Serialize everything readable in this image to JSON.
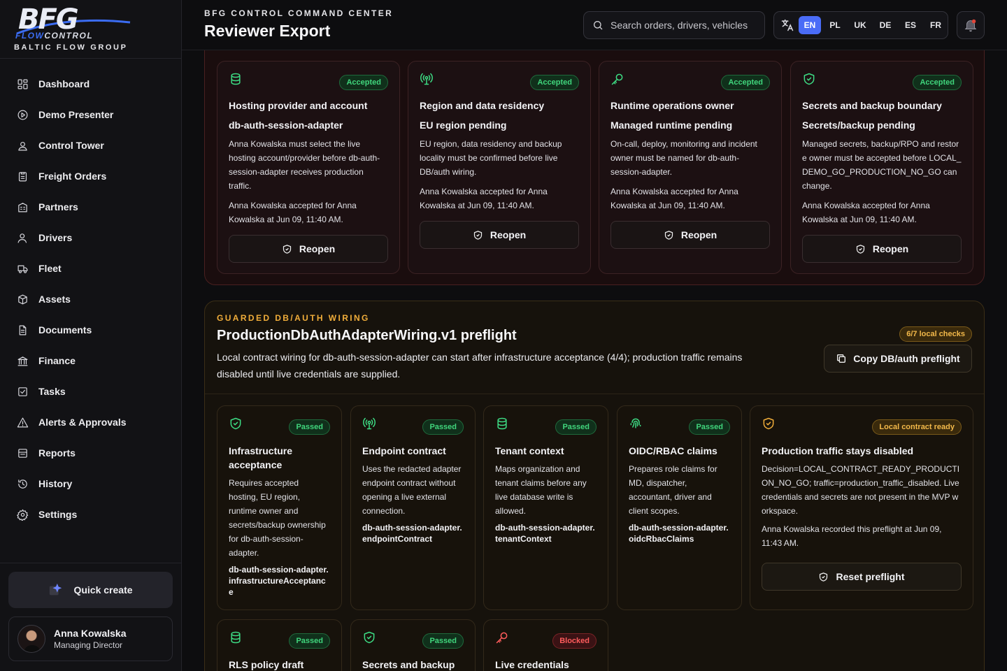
{
  "brand": {
    "logo": "BFG",
    "logo_flow": "FLOW",
    "logo_control": "CONTROL",
    "subtitle": "BALTIC FLOW GROUP"
  },
  "sidebar": {
    "items": [
      {
        "label": "Dashboard",
        "icon": "grid-icon"
      },
      {
        "label": "Demo Presenter",
        "icon": "play-circle-icon"
      },
      {
        "label": "Control Tower",
        "icon": "user-badge-icon"
      },
      {
        "label": "Freight Orders",
        "icon": "clipboard-icon"
      },
      {
        "label": "Partners",
        "icon": "building-icon"
      },
      {
        "label": "Drivers",
        "icon": "user-icon"
      },
      {
        "label": "Fleet",
        "icon": "truck-icon"
      },
      {
        "label": "Assets",
        "icon": "box-icon"
      },
      {
        "label": "Documents",
        "icon": "document-icon"
      },
      {
        "label": "Finance",
        "icon": "bank-icon"
      },
      {
        "label": "Tasks",
        "icon": "check-square-icon"
      },
      {
        "label": "Alerts & Approvals",
        "icon": "alert-triangle-icon"
      },
      {
        "label": "Reports",
        "icon": "report-icon"
      },
      {
        "label": "History",
        "icon": "history-icon"
      },
      {
        "label": "Settings",
        "icon": "gear-icon"
      }
    ],
    "quick_create": "Quick create",
    "user": {
      "name": "Anna Kowalska",
      "role": "Managing Director"
    }
  },
  "header": {
    "eyebrow": "BFG CONTROL COMMAND CENTER",
    "title": "Reviewer Export",
    "search_placeholder": "Search orders, drivers, vehicles",
    "languages": [
      "EN",
      "PL",
      "UK",
      "DE",
      "ES",
      "FR"
    ],
    "active_language": "EN"
  },
  "accepted": {
    "cards": [
      {
        "icon": "database-icon",
        "badge": "Accepted",
        "title": "Hosting provider and account",
        "subtitle": "db-auth-session-adapter",
        "description": "Anna Kowalska must select the live hosting account/provider before db-auth-session-adapter receives production traffic.",
        "note": "Anna Kowalska accepted for Anna Kowalska at Jun 09, 11:40 AM.",
        "button": "Reopen"
      },
      {
        "icon": "antenna-icon",
        "badge": "Accepted",
        "title": "Region and data residency",
        "subtitle": "EU region pending",
        "description": "EU region, data residency and backup locality must be confirmed before live DB/auth wiring.",
        "note": "Anna Kowalska accepted for Anna Kowalska at Jun 09, 11:40 AM.",
        "button": "Reopen"
      },
      {
        "icon": "key-icon",
        "badge": "Accepted",
        "title": "Runtime operations owner",
        "subtitle": "Managed runtime pending",
        "description": "On-call, deploy, monitoring and incident owner must be named for db-auth-session-adapter.",
        "note": "Anna Kowalska accepted for Anna Kowalska at Jun 09, 11:40 AM.",
        "button": "Reopen"
      },
      {
        "icon": "shield-check-icon",
        "badge": "Accepted",
        "title": "Secrets and backup boundary",
        "subtitle": "Secrets/backup pending",
        "description": "Managed secrets, backup/RPO and restore owner must be accepted before LOCAL_DEMO_GO_PRODUCTION_NO_GO can change.",
        "note": "Anna Kowalska accepted for Anna Kowalska at Jun 09, 11:40 AM.",
        "button": "Reopen"
      }
    ]
  },
  "guarded": {
    "eyebrow": "GUARDED DB/AUTH WIRING",
    "title": "ProductionDbAuthAdapterWiring.v1 preflight",
    "description": "Local contract wiring for db-auth-session-adapter can start after infrastructure acceptance (4/4); production traffic remains disabled until live credentials are supplied.",
    "count_badge": "6/7 local checks",
    "copy_button": "Copy DB/auth preflight",
    "checks": [
      {
        "icon": "shield-check-icon",
        "badge": "Passed",
        "title": "Infrastructure acceptance",
        "description": "Requires accepted hosting, EU region, runtime owner and secrets/backup ownership for db-auth-session-adapter.",
        "code": "db-auth-session-adapter.infrastructureAcceptance"
      },
      {
        "icon": "antenna-icon",
        "badge": "Passed",
        "title": "Endpoint contract",
        "description": "Uses the redacted adapter endpoint contract without opening a live external connection.",
        "code": "db-auth-session-adapter.endpointContract"
      },
      {
        "icon": "database-icon",
        "badge": "Passed",
        "title": "Tenant context",
        "description": "Maps organization and tenant claims before any live database write is allowed.",
        "code": "db-auth-session-adapter.tenantContext"
      },
      {
        "icon": "fingerprint-icon",
        "badge": "Passed",
        "title": "OIDC/RBAC claims",
        "description": "Prepares role claims for MD, dispatcher, accountant, driver and client scopes.",
        "code": "db-auth-session-adapter.oidcRbacClaims"
      },
      {
        "icon": "database-icon",
        "badge": "Passed",
        "title": "RLS policy draft"
      },
      {
        "icon": "shield-check-icon",
        "badge": "Passed",
        "title": "Secrets and backup"
      },
      {
        "icon": "key-icon",
        "badge": "Blocked",
        "title": "Live credentials"
      }
    ],
    "decision": {
      "icon": "shield-check-icon",
      "badge": "Local contract ready",
      "title": "Production traffic stays disabled",
      "description": "Decision=LOCAL_CONTRACT_READY_PRODUCTION_NO_GO; traffic=production_traffic_disabled. Live credentials and secrets are not present in the MVP workspace.",
      "note": "Anna Kowalska recorded this preflight at Jun 09, 11:43 AM.",
      "button": "Reset preflight"
    }
  }
}
